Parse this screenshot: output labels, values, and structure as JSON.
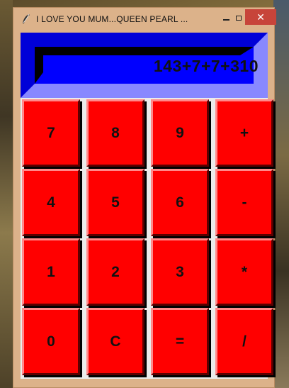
{
  "window": {
    "title": "I LOVE YOU MUM...QUEEN PEARL ...",
    "close_glyph": "✕"
  },
  "display": {
    "value": "143+7+7+310"
  },
  "keys": [
    {
      "label": "7"
    },
    {
      "label": "8"
    },
    {
      "label": "9"
    },
    {
      "label": "+"
    },
    {
      "label": "4"
    },
    {
      "label": "5"
    },
    {
      "label": "6"
    },
    {
      "label": "-"
    },
    {
      "label": "1"
    },
    {
      "label": "2"
    },
    {
      "label": "3"
    },
    {
      "label": "*"
    },
    {
      "label": "0"
    },
    {
      "label": "C"
    },
    {
      "label": "="
    },
    {
      "label": "/"
    }
  ],
  "colors": {
    "key": "#ff0000",
    "display_bg": "#0000ff",
    "display_frame": "#8888ff",
    "window_frame": "#dcb28a",
    "close_button": "#c7443a"
  },
  "icons": {
    "app": "feather-icon",
    "minimize": "minimize-icon",
    "maximize": "maximize-icon",
    "close": "close-icon"
  }
}
